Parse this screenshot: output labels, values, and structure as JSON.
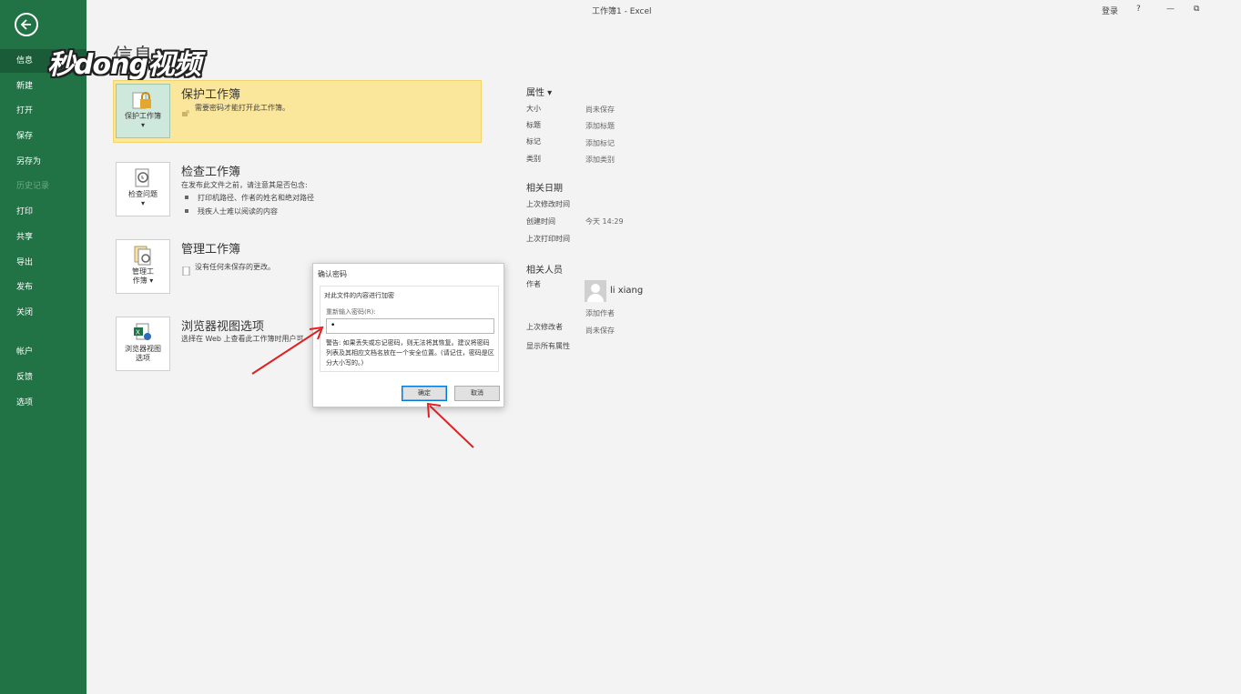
{
  "window": {
    "title": "工作簿1  -  Excel",
    "signin": "登录",
    "help": "?",
    "restore": "⧉"
  },
  "watermark": "秒dong视频",
  "page_title": "信息",
  "sidebar": {
    "items": [
      {
        "label": "信息"
      },
      {
        "label": "新建"
      },
      {
        "label": "打开"
      },
      {
        "label": "保存"
      },
      {
        "label": "另存为"
      },
      {
        "label": "历史记录"
      },
      {
        "label": "打印"
      },
      {
        "label": "共享"
      },
      {
        "label": "导出"
      },
      {
        "label": "发布"
      },
      {
        "label": "关闭"
      },
      {
        "label": "帐户"
      },
      {
        "label": "反馈"
      },
      {
        "label": "选项"
      }
    ]
  },
  "sections": {
    "protect": {
      "tile_label": "保护工作簿",
      "tile_caret": "▾",
      "title": "保护工作簿",
      "desc": "需要密码才能打开此工作簿。"
    },
    "inspect": {
      "tile_label": "检查问题",
      "tile_caret": "▾",
      "title": "检查工作簿",
      "desc": "在发布此文件之前，请注意其是否包含:",
      "bullets": [
        "打印机路径、作者的姓名和绝对路径",
        "残疾人士难以阅读的内容"
      ]
    },
    "manage": {
      "tile_label1": "管理工",
      "tile_label2": "作簿 ▾",
      "title": "管理工作簿",
      "desc": "没有任何未保存的更改。"
    },
    "browser": {
      "tile_label1": "浏览器视图",
      "tile_label2": "选项",
      "title": "浏览器视图选项",
      "desc": "选择在 Web 上查看此工作簿时用户可"
    }
  },
  "properties": {
    "header": "属性 ▾",
    "rows": [
      {
        "label": "大小",
        "value": "尚未保存"
      },
      {
        "label": "标题",
        "value": "添加标题"
      },
      {
        "label": "标记",
        "value": "添加标记"
      },
      {
        "label": "类别",
        "value": "添加类别"
      }
    ],
    "dates_header": "相关日期",
    "dates": [
      {
        "label": "上次修改时间",
        "value": ""
      },
      {
        "label": "创建时间",
        "value": "今天 14:29"
      },
      {
        "label": "上次打印时间",
        "value": ""
      }
    ],
    "people_header": "相关人员",
    "author_label": "作者",
    "author_name": "li xiang",
    "add_author": "添加作者",
    "last_modified_by_label": "上次修改者",
    "last_modified_by_value": "尚未保存",
    "show_all": "显示所有属性"
  },
  "dialog": {
    "title": "确认密码",
    "group": "对此文件的内容进行加密",
    "label": "重新输入密码(R):",
    "value": "•",
    "warning": "警告: 如果丢失或忘记密码，则无法将其恢复。建议将密码列表及其相应文档名放在一个安全位置。(请记住，密码是区分大小写的。)",
    "ok": "确定",
    "cancel": "取消"
  },
  "colors": {
    "sidebar": "#217346",
    "highlight": "#fbe79c",
    "arrow": "#e02020"
  }
}
